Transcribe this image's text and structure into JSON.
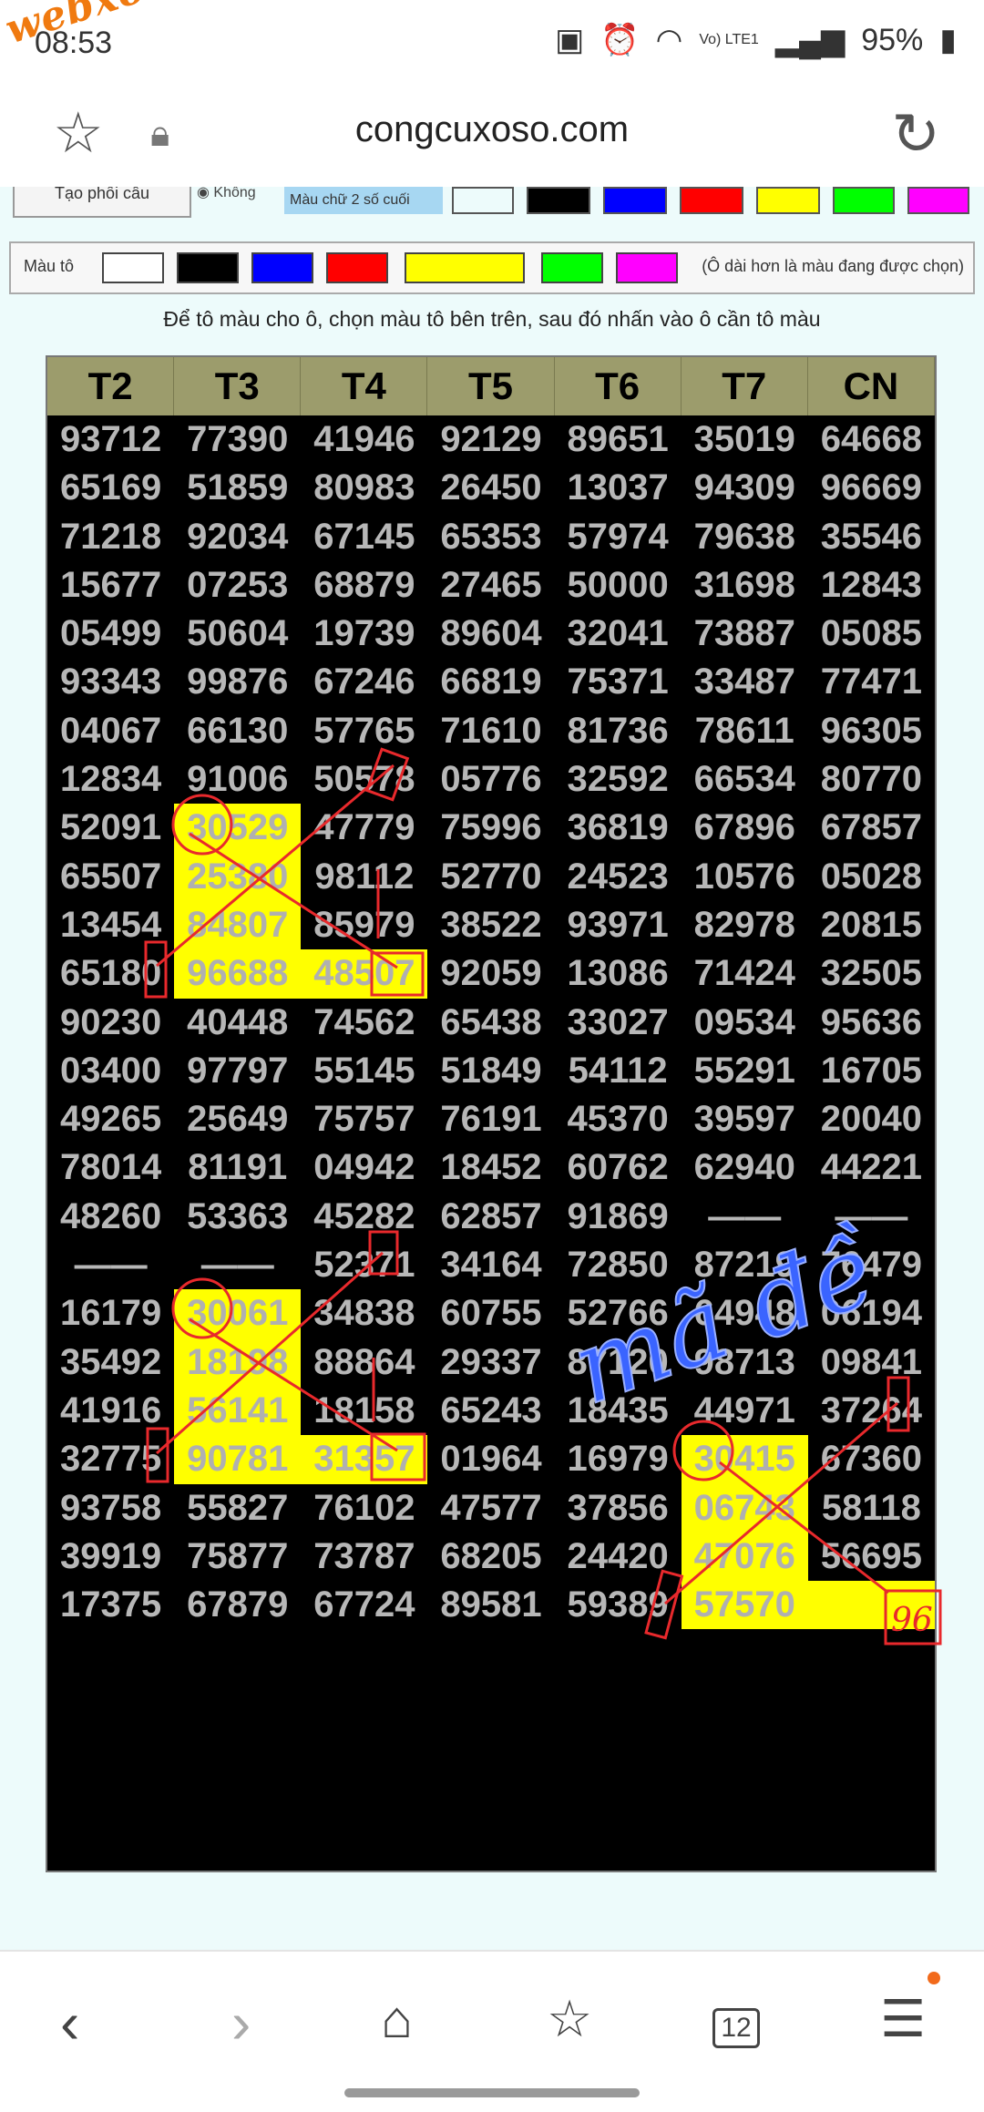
{
  "status_bar": {
    "time": "08:53",
    "watermark": "webxoso.net",
    "battery": "95%",
    "network": "Vo) LTE1"
  },
  "browser": {
    "url": "congcuxoso.com"
  },
  "toolbar": {
    "btn_tao": "Tạo phối cầu",
    "radio_khong": "Không",
    "mau_chu_label": "Màu chữ 2 số cuối",
    "mau_to_label": "Màu tô",
    "mau_to_note": "(Ô dài hơn là màu đang được chọn)",
    "instruction": "Để tô màu cho ô, chọn màu tô bên trên, sau đó nhấn vào ô cần tô màu"
  },
  "colors": [
    "#ffffff",
    "#000000",
    "#0000ff",
    "#ff0000",
    "#ffff00",
    "#00ff00",
    "#ff00ff"
  ],
  "table": {
    "headers": [
      "T2",
      "T3",
      "T4",
      "T5",
      "T6",
      "T7",
      "CN"
    ],
    "rows": [
      [
        "93712",
        "77390",
        "41946",
        "92129",
        "89651",
        "35019",
        "64668"
      ],
      [
        "65169",
        "51859",
        "80983",
        "26450",
        "13037",
        "94309",
        "96669"
      ],
      [
        "71218",
        "92034",
        "67145",
        "65353",
        "57974",
        "79638",
        "35546"
      ],
      [
        "15677",
        "07253",
        "68879",
        "27465",
        "50000",
        "31698",
        "12843"
      ],
      [
        "05499",
        "50604",
        "19739",
        "89604",
        "32041",
        "73887",
        "05085"
      ],
      [
        "93343",
        "99876",
        "67246",
        "66819",
        "75371",
        "33487",
        "77471"
      ],
      [
        "04067",
        "66130",
        "57765",
        "71610",
        "81736",
        "78611",
        "96305"
      ],
      [
        "12834",
        "91006",
        "50578",
        "05776",
        "32592",
        "66534",
        "80770"
      ],
      [
        "52091",
        "30529",
        "47779",
        "75996",
        "36819",
        "67896",
        "67857"
      ],
      [
        "65507",
        "25380",
        "98112",
        "52770",
        "24523",
        "10576",
        "05028"
      ],
      [
        "13454",
        "84807",
        "85979",
        "38522",
        "93971",
        "82978",
        "20815"
      ],
      [
        "65180",
        "96688",
        "48507",
        "92059",
        "13086",
        "71424",
        "32505"
      ],
      [
        "90230",
        "40448",
        "74562",
        "65438",
        "33027",
        "09534",
        "95636"
      ],
      [
        "03400",
        "97797",
        "55145",
        "51849",
        "54112",
        "55291",
        "16705"
      ],
      [
        "49265",
        "25649",
        "75757",
        "76191",
        "45370",
        "39597",
        "20040"
      ],
      [
        "78014",
        "81191",
        "04942",
        "18452",
        "60762",
        "62940",
        "44221"
      ],
      [
        "48260",
        "53363",
        "45282",
        "62857",
        "91869",
        "——",
        "——"
      ],
      [
        "——",
        "——",
        "52371",
        "34164",
        "72850",
        "87219",
        "76479"
      ],
      [
        "16179",
        "30061",
        "34838",
        "60755",
        "52766",
        "64948",
        "06194"
      ],
      [
        "35492",
        "18198",
        "88864",
        "29337",
        "87120",
        "98713",
        "09841"
      ],
      [
        "41916",
        "56141",
        "18158",
        "65243",
        "18435",
        "44971",
        "37264"
      ],
      [
        "32775",
        "90781",
        "31357",
        "01964",
        "16979",
        "30415",
        "67360"
      ],
      [
        "93758",
        "55827",
        "76102",
        "47577",
        "37856",
        "06743",
        "58118"
      ],
      [
        "39919",
        "75877",
        "73787",
        "68205",
        "24420",
        "47076",
        "56695"
      ],
      [
        "17375",
        "67879",
        "67724",
        "89581",
        "59389",
        "57570",
        ""
      ]
    ]
  },
  "annotations": {
    "handwriting": "mã đề",
    "circled_number": "96"
  }
}
